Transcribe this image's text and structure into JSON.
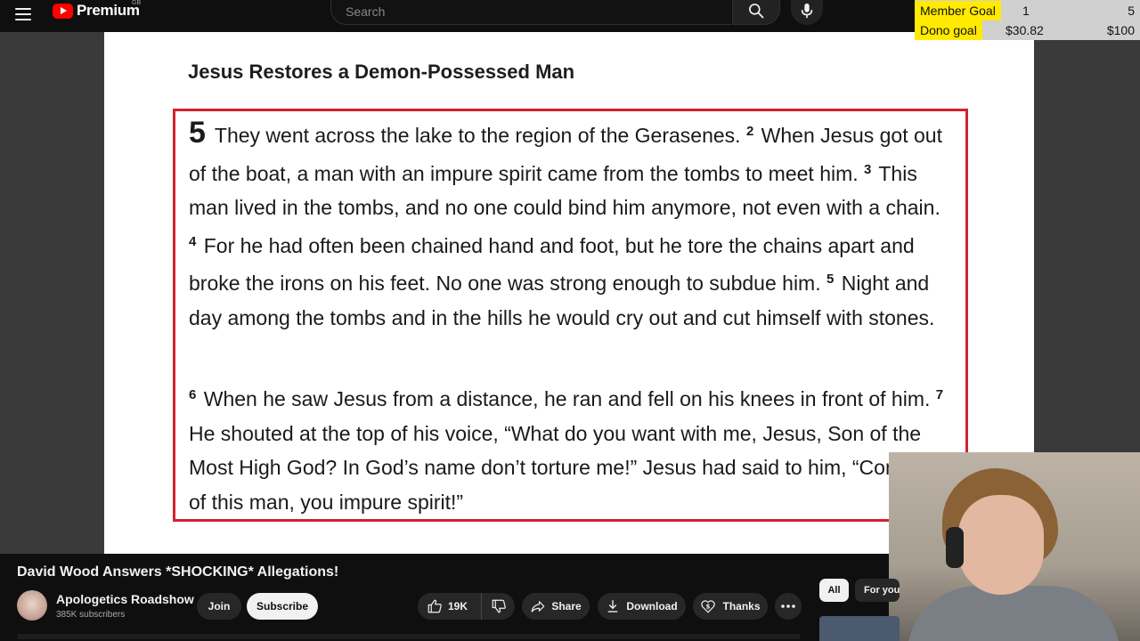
{
  "header": {
    "logo_text": "Premium",
    "logo_country": "GB",
    "search_placeholder": "Search"
  },
  "stream_goals": {
    "member": {
      "label": "Member Goal",
      "current": "1",
      "target": "5"
    },
    "dono": {
      "label": "Dono goal",
      "current": "$30.82",
      "target": "$100"
    }
  },
  "video_content": {
    "heading": "Jesus Restores a Demon-Possessed Man",
    "paragraph1": [
      {
        "type": "chapter",
        "text": "5"
      },
      {
        "type": "text",
        "text": " They went across the lake to the region of the Gerasenes. "
      },
      {
        "type": "verse",
        "text": "2"
      },
      {
        "type": "text",
        "text": " When Jesus got out of the boat, a man with an impure spirit came from the tombs to meet him. "
      },
      {
        "type": "verse",
        "text": "3"
      },
      {
        "type": "text",
        "text": " This man lived in the tombs, and no one could bind him anymore, not even with a chain. "
      },
      {
        "type": "verse",
        "text": "4"
      },
      {
        "type": "text",
        "text": " For he had often been chained hand and foot, but he tore the chains apart and broke the irons on his feet. No one was strong enough to subdue him. "
      },
      {
        "type": "verse",
        "text": "5"
      },
      {
        "type": "text",
        "text": " Night and day among the tombs and in the hills he would cry out and cut himself with stones."
      }
    ],
    "paragraph2": [
      {
        "type": "verse",
        "text": "6"
      },
      {
        "type": "text",
        "text": " When he saw Jesus from a distance, he ran and fell on his knees in front of him. "
      },
      {
        "type": "verse",
        "text": "7"
      },
      {
        "type": "text",
        "text": " He shouted at the top of his voice, “What do you want with me, Jesus, Son of the Most High God? In God’s name don’t torture me!” Jesus had said to him, “Come out of this man, you impure spirit!”"
      }
    ]
  },
  "video": {
    "title": "David Wood Answers *SHOCKING* Allegations!",
    "channel": "Apologetics Roadshow",
    "subscribers": "385K subscribers"
  },
  "actions": {
    "join": "Join",
    "subscribe": "Subscribe",
    "likes": "19K",
    "share": "Share",
    "download": "Download",
    "thanks": "Thanks"
  },
  "chips": {
    "all": "All",
    "for_you": "For you"
  },
  "colors": {
    "accent_red": "#ff0000",
    "scripture_border": "#d6202e",
    "goal_highlight": "#ffea00"
  }
}
